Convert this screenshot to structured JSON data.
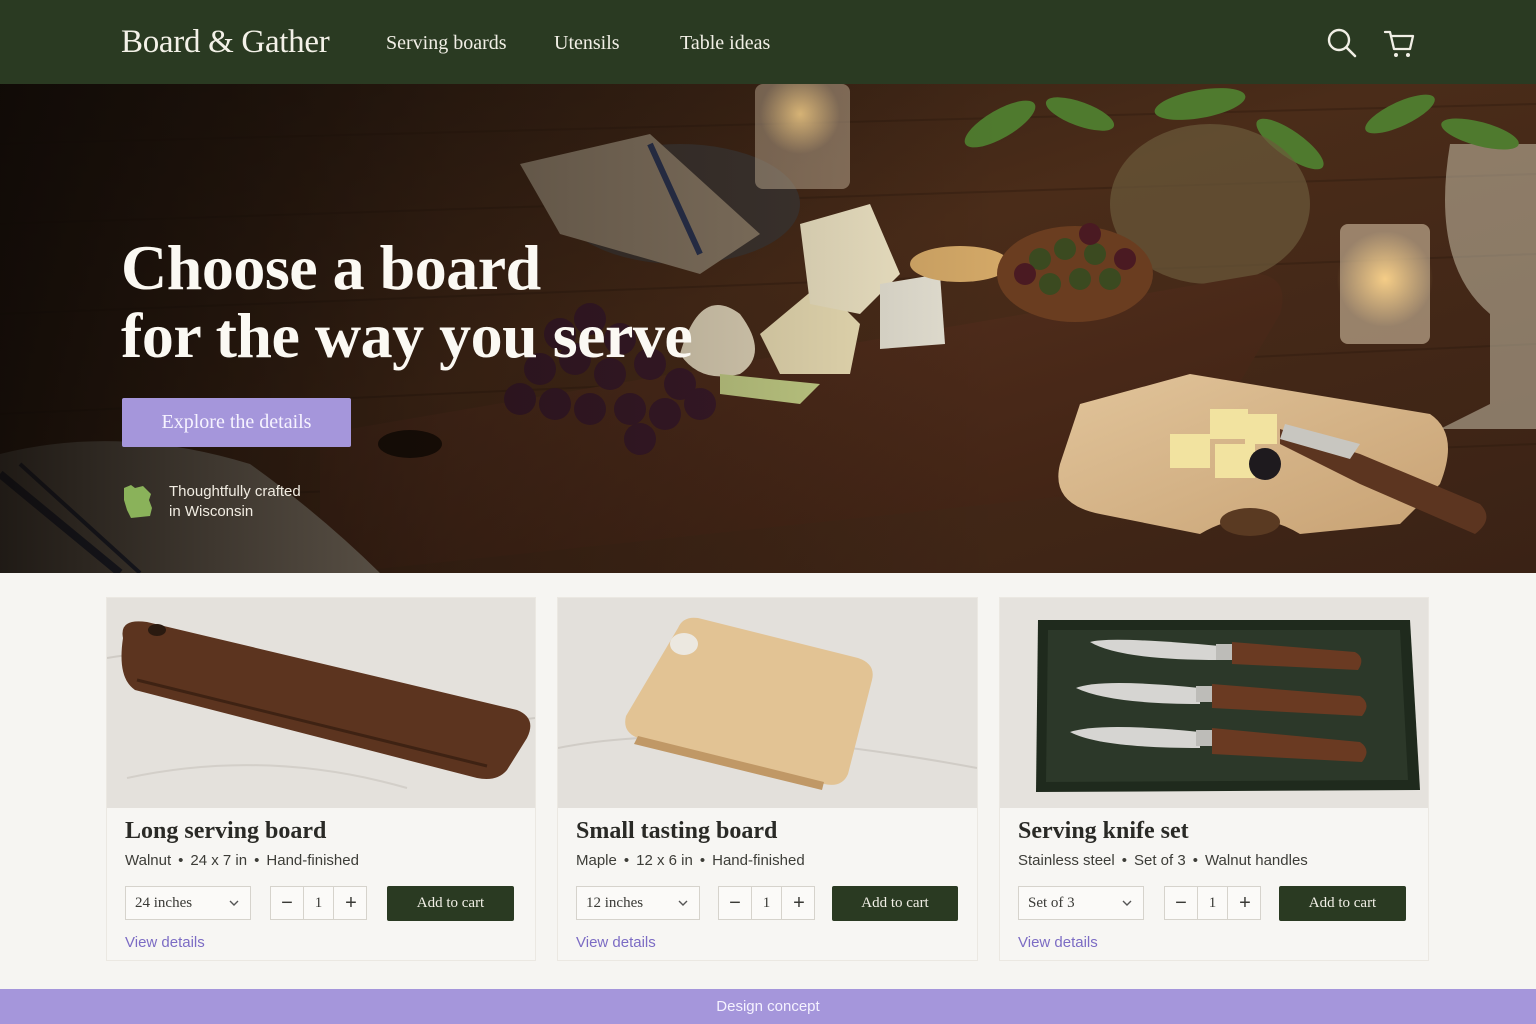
{
  "nav": {
    "brand": "Board & Gather",
    "links": [
      "Serving boards",
      "Utensils",
      "Table ideas"
    ],
    "icons": [
      "search-icon",
      "cart-icon"
    ]
  },
  "hero": {
    "title_line1": "Choose a board",
    "title_line2": "for the way you serve",
    "cta": "Explore the details",
    "origin_line1": "Thoughtfully crafted",
    "origin_line2": "in Wisconsin"
  },
  "products": [
    {
      "title": "Long serving board",
      "meta": [
        "Walnut",
        "24 x 7 in",
        "Hand-finished"
      ],
      "option": "24 inches",
      "qty": "1",
      "add_label": "Add to cart",
      "link": "View details"
    },
    {
      "title": "Small tasting board",
      "meta": [
        "Maple",
        "12 x 6 in",
        "Hand-finished"
      ],
      "option": "12 inches",
      "qty": "1",
      "add_label": "Add to cart",
      "link": "View details"
    },
    {
      "title": "Serving knife set",
      "meta": [
        "Stainless steel",
        "Set of 3",
        "Walnut handles"
      ],
      "option": "Set of 3",
      "qty": "1",
      "add_label": "Add to cart",
      "link": "View details"
    }
  ],
  "stepper": {
    "minus": "−",
    "plus": "+"
  },
  "footer": {
    "label": "Design concept"
  },
  "colors": {
    "nav": "#2a3a22",
    "accent": "#a596db",
    "link": "#7c6cc4"
  }
}
